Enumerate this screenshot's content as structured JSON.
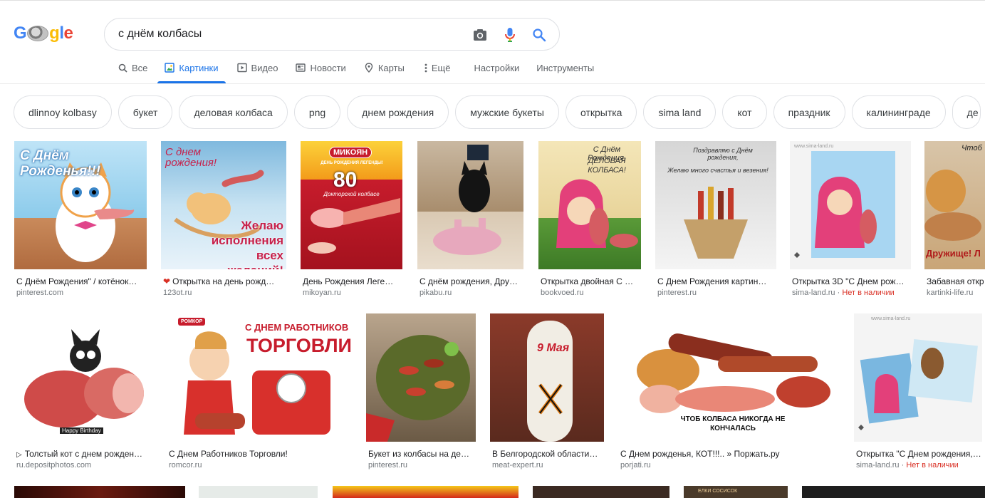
{
  "logo": {
    "text": "Google"
  },
  "search": {
    "query": "с днём колбасы"
  },
  "tabs": [
    {
      "label": "Все",
      "icon": "search-icon"
    },
    {
      "label": "Картинки",
      "icon": "image-icon"
    },
    {
      "label": "Видео",
      "icon": "video-icon"
    },
    {
      "label": "Новости",
      "icon": "news-icon"
    },
    {
      "label": "Карты",
      "icon": "map-pin-icon"
    },
    {
      "label": "Ещё",
      "icon": "more-vert-icon"
    },
    {
      "label": "Настройки"
    },
    {
      "label": "Инструменты"
    }
  ],
  "chips": [
    "dlinnoy kolbasy",
    "букет",
    "деловая колбаса",
    "png",
    "днем рождения",
    "мужские букеты",
    "открытка",
    "sima land",
    "кот",
    "праздник",
    "калининграде",
    "де"
  ],
  "row1": [
    {
      "caption": "С Днём Рождения\" / котёнок…",
      "source": "pinterest.com"
    },
    {
      "caption": "Открытка на день рожд…",
      "source": "123ot.ru",
      "heart": true
    },
    {
      "caption": "День Рождения Леге…",
      "source": "mikoyan.ru"
    },
    {
      "caption": "С днём рождения, Дру…",
      "source": "pikabu.ru"
    },
    {
      "caption": "Открытка двойная С …",
      "source": "bookvoed.ru"
    },
    {
      "caption": "С Днем Рождения картин…",
      "source": "pinterest.ru"
    },
    {
      "caption": "Открытка 3D \"С Днем рож…",
      "source": "sima-land.ru",
      "badge": "Нет в наличии"
    },
    {
      "caption": "Забавная откр",
      "source": "kartinki-life.ru"
    }
  ],
  "row2": [
    {
      "caption": "Толстый кот с днем рожден…",
      "source": "ru.depositphotos.com",
      "play": true
    },
    {
      "caption": "С Днем Работников Торговли!",
      "source": "romcor.ru"
    },
    {
      "caption": "Букет из колбасы на де…",
      "source": "pinterest.ru"
    },
    {
      "caption": "В Белгородской области…",
      "source": "meat-expert.ru"
    },
    {
      "caption": "С Днем рожденья, КОТ!!!.. » Поржать.ру",
      "source": "porjati.ru"
    },
    {
      "caption": "Открытка \"С Днем рождения, …",
      "source": "sima-land.ru",
      "badge": "Нет в наличии"
    }
  ],
  "thumb_text": {
    "t1": "С Днём Рожденья!!!",
    "t2a": "С днем рождения!",
    "t2b": "Желаю исполнения всех желаний!",
    "t3a": "МИКОЯН",
    "t3b": "ДЕНЬ РОЖДЕНИЯ ЛЕГЕНДЫ!",
    "t3c": "80",
    "t3d": "Докторской колбасе",
    "t5a": "С Днём Рождения,",
    "t5b": "ДЕЛОВАЯ КОЛБАСА!",
    "t6a": "Поздравляю с Днём рождения,",
    "t6b": "Желаю много счастья и везения!",
    "t7": "www.sima-land.ru",
    "t8a": "Чтоб",
    "t8b": "Дружище! Л",
    "r2t1": "Happy Birthday",
    "r2t2a": "РОМКОР",
    "r2t2b": "С ДНЕМ РАБОТНИКОВ",
    "r2t2c": "ТОРГОВЛИ!",
    "r2t4": "9 Мая",
    "r2t5": "ЧТОБ КОЛБАСА НИКОГДА НЕ КОНЧАЛАСЬ",
    "r2t6": "www.sima-land.ru",
    "b1": "",
    "b5": "ЕЛКИ СОСИСОК"
  },
  "colors": {
    "accent": "#1a73e8",
    "unavailable": "#d93025"
  }
}
